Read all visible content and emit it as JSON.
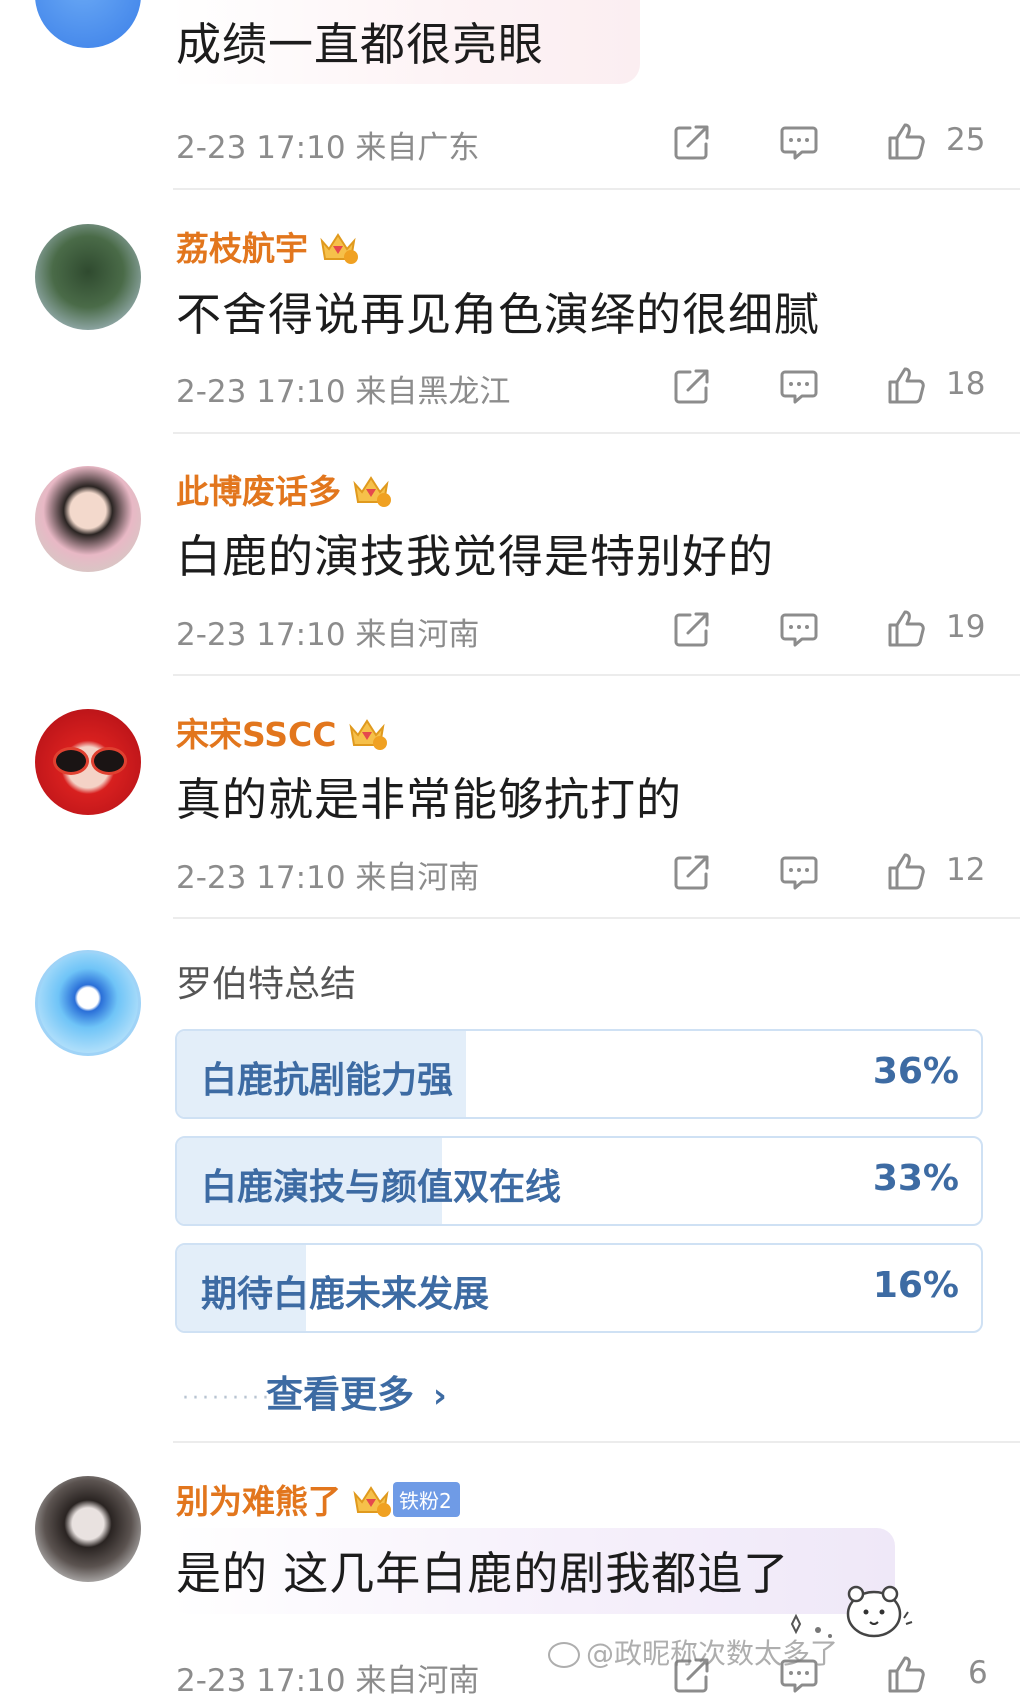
{
  "comments": [
    {
      "name": "",
      "text": "成绩一直都很亮眼",
      "time": "2-23 17:10",
      "location": "来自广东",
      "likes": "25"
    },
    {
      "name": "荔枝航宇",
      "text": "不舍得说再见角色演绎的很细腻",
      "time": "2-23 17:10",
      "location": "来自黑龙江",
      "likes": "18"
    },
    {
      "name": "此博废话多",
      "text": "白鹿的演技我觉得是特别好的",
      "time": "2-23 17:10",
      "location": "来自河南",
      "likes": "19"
    },
    {
      "name": "宋宋SSCC",
      "text": "真的就是非常能够抗打的",
      "time": "2-23 17:10",
      "location": "来自河南",
      "likes": "12"
    },
    {
      "name": "别为难熊了",
      "fan_badge": "铁粉2",
      "text": "是的 这几年白鹿的剧我都追了",
      "time": "2-23 17:10",
      "location": "来自河南",
      "likes": "6"
    }
  ],
  "poll": {
    "title": "罗伯特总结",
    "options": [
      {
        "label": "白鹿抗剧能力强",
        "pct_text": "36%",
        "pct": 36
      },
      {
        "label": "白鹿演技与颜值双在线",
        "pct_text": "33%",
        "pct": 33
      },
      {
        "label": "期待白鹿未来发展",
        "pct_text": "16%",
        "pct": 16
      }
    ],
    "more_label": "查看更多",
    "more_chevron": "›"
  },
  "watermark": "@政昵称次数太多了",
  "colors": {
    "name": "#e2761d",
    "poll_text": "#3d6ba3",
    "poll_fill": "#e3eef9"
  }
}
